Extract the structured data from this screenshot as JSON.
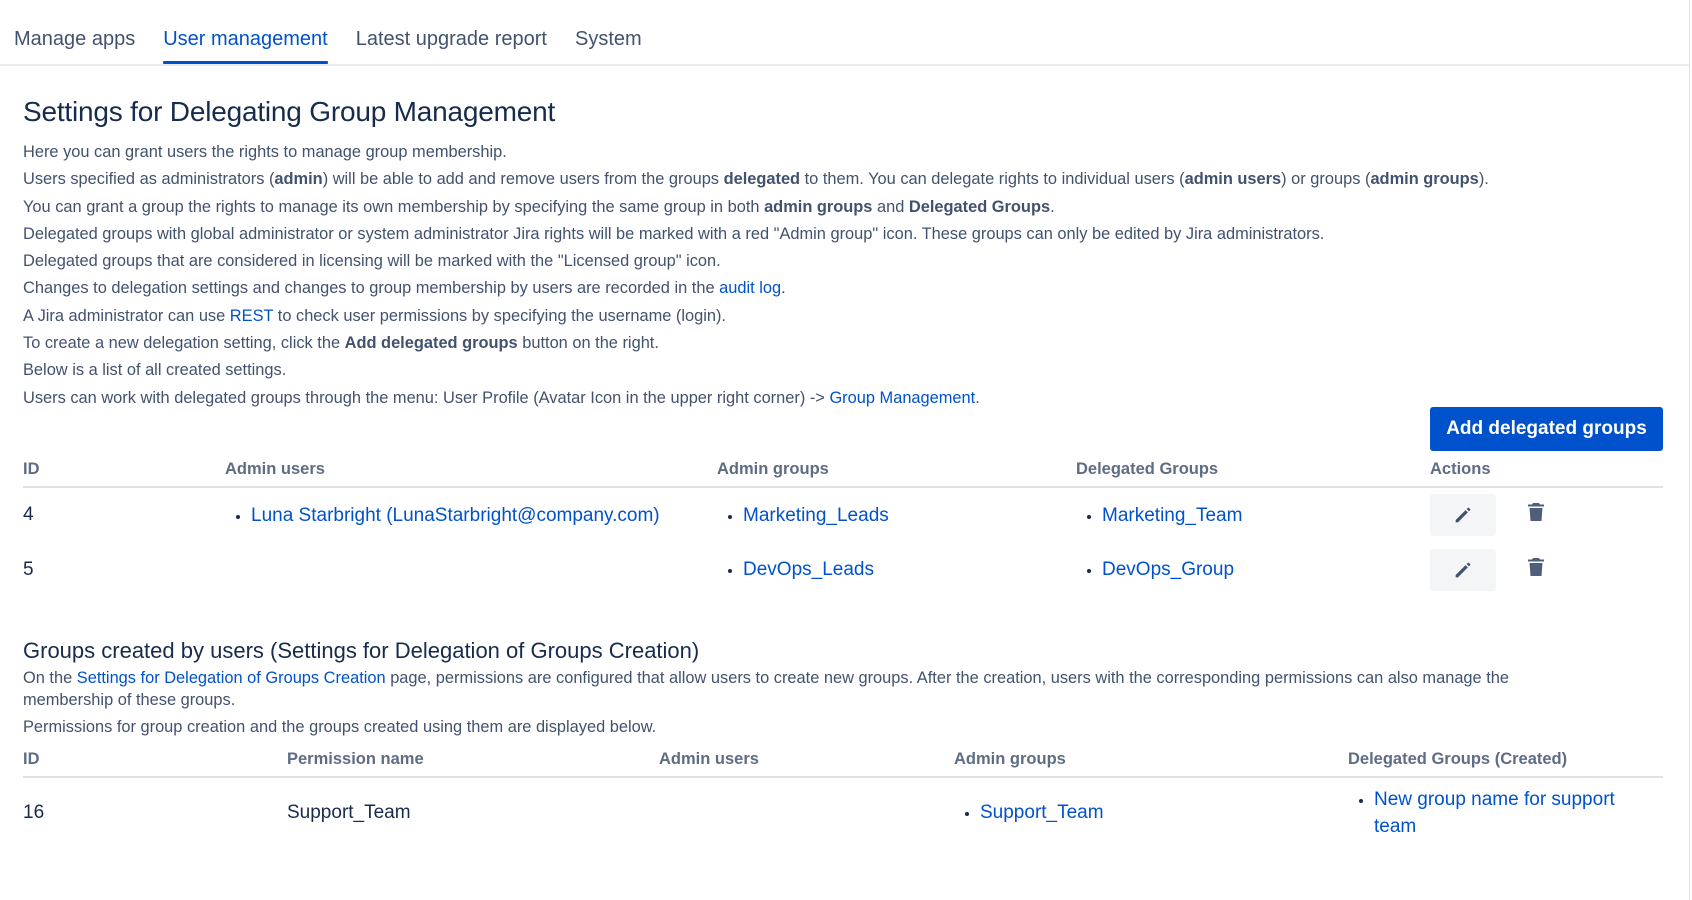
{
  "tabs": [
    {
      "label": "Manage apps"
    },
    {
      "label": "User management"
    },
    {
      "label": "Latest upgrade report"
    },
    {
      "label": "System"
    }
  ],
  "page_title": "Settings for Delegating Group Management",
  "intro": {
    "l1": "Here you can grant users the rights to manage group membership.",
    "l2": [
      "Users specified as administrators (",
      "admin",
      ") will be able to add and remove users from the groups ",
      "delegated",
      " to them. You can delegate rights to individual users (",
      "admin users",
      ") or groups (",
      "admin groups",
      ")."
    ],
    "l3": [
      "You can grant a group the rights to manage its own membership by specifying the same group in both ",
      "admin groups",
      " and ",
      "Delegated Groups",
      "."
    ],
    "l4": "Delegated groups with global administrator or system administrator Jira rights will be marked with a red \"Admin group\" icon. These groups can only be edited by Jira administrators.",
    "l5": "Delegated groups that are considered in licensing will be marked with the \"Licensed group\" icon.",
    "l6": [
      "Changes to delegation settings and changes to group membership by users are recorded in the ",
      "audit log",
      "."
    ],
    "l7": [
      "A Jira administrator can use ",
      "REST",
      " to check user permissions by specifying the username (login)."
    ],
    "l8": [
      "To create a new delegation setting, click the ",
      "Add delegated groups",
      " button on the right."
    ],
    "l9": "Below is a list of all created settings.",
    "l10": [
      "Users can work with delegated groups through the menu: User Profile (Avatar Icon in the upper right corner) -> ",
      "Group Management",
      "."
    ]
  },
  "add_button_label": "Add delegated groups",
  "delegation_table": {
    "headers": [
      "ID",
      "Admin users",
      "Admin groups",
      "Delegated Groups",
      "Actions"
    ],
    "rows": [
      {
        "id": "4",
        "admin_user": "Luna Starbright (LunaStarbright@company.com)",
        "admin_group": "Marketing_Leads",
        "delegated_group": "Marketing_Team"
      },
      {
        "id": "5",
        "admin_user": "",
        "admin_group": "DevOps_Leads",
        "delegated_group": "DevOps_Group"
      }
    ]
  },
  "creation": {
    "title": "Groups created by users (Settings for Delegation of Groups Creation)",
    "desc1": [
      "On the ",
      "Settings for Delegation of Groups Creation",
      " page, permissions are configured that allow users to create new groups. After the creation, users with the corresponding permissions can also manage the"
    ],
    "desc1b": "membership of these groups.",
    "desc2": "Permissions for group creation and the groups created using them are displayed below.",
    "headers": [
      "ID",
      "Permission name",
      "Admin users",
      "Admin groups",
      "Delegated Groups (Created)"
    ],
    "rows": [
      {
        "id": "16",
        "permission": "Support_Team",
        "admin_users": "",
        "admin_group": "Support_Team",
        "created_l1": "New group name for support",
        "created_l2": "team"
      }
    ]
  },
  "icons": {
    "edit": "pencil-icon",
    "delete": "trash-icon"
  },
  "colors": {
    "primary": "#0052cc",
    "text": "#172b4d",
    "muted": "#42526e"
  }
}
